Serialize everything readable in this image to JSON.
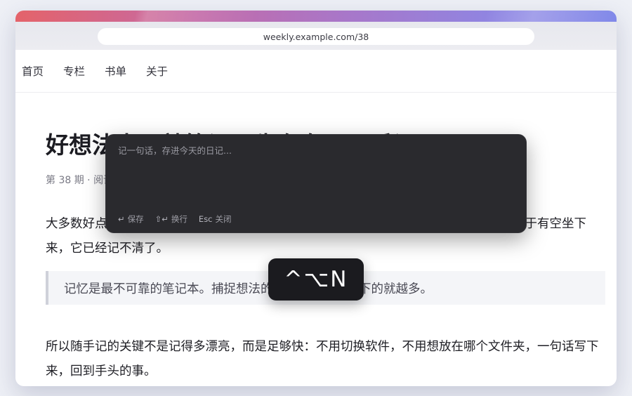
{
  "browser": {
    "url": "weekly.example.com/38"
  },
  "nav": {
    "items": [
      {
        "label": "首页"
      },
      {
        "label": "专栏"
      },
      {
        "label": "书单"
      },
      {
        "label": "关于"
      }
    ]
  },
  "article": {
    "title": "好想法来了就笔记：先存在日历手记",
    "meta": "第 38 期 · 阅读 4 分钟",
    "para1": "大多数好点子都不是坐在书桌前想出来的，而是在路上、排队、洗澡时冒出来的。等你终于有空坐下来，它已经记不清了。",
    "quote": "记忆是最不可靠的笔记本。捕捉想法的成本越低，你留下的就越多。",
    "para2": "所以随手记的关键不是记得多漂亮，而是足够快：不用切换软件，不用想放在哪个文件夹，一句话写下来，回到手头的事。"
  },
  "composer": {
    "placeholder": "记一句话，存进今天的日记...",
    "value": "",
    "hints": [
      {
        "key": "↵",
        "label": "保存"
      },
      {
        "key": "⇧↵",
        "label": "换行"
      },
      {
        "key": "Esc",
        "label": "关闭"
      }
    ]
  },
  "shortcut": {
    "keys": "^⌥N"
  }
}
